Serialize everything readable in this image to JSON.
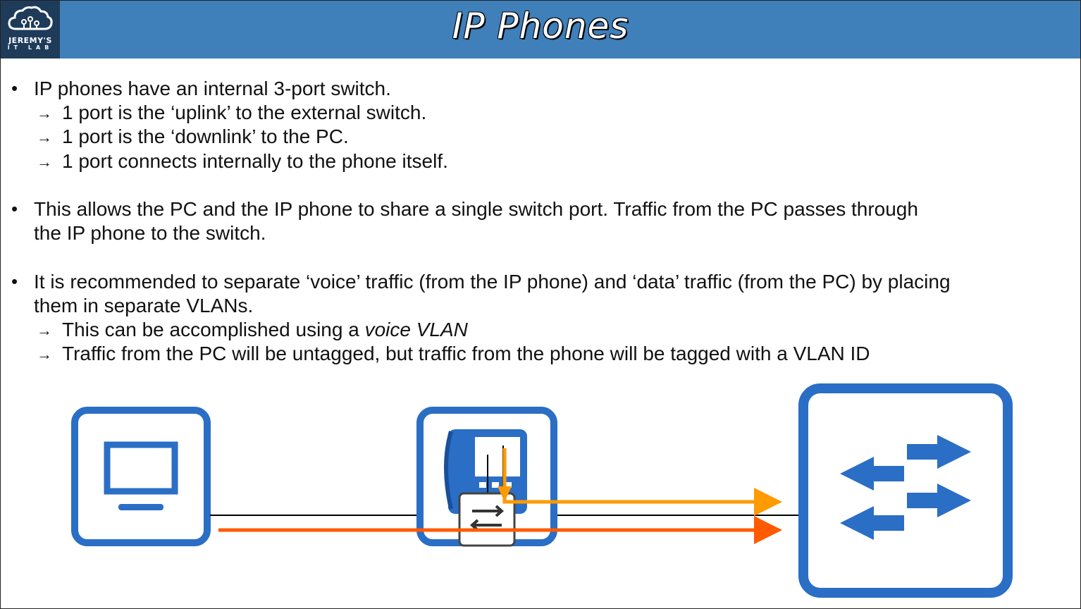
{
  "header": {
    "logo": {
      "line1": "JEREMY'S",
      "line2": "IT LAB",
      "icon": "cloud-network-icon"
    },
    "title": "IP Phones"
  },
  "bullets": [
    {
      "text": "IP phones have an internal 3-port switch.",
      "subs": [
        "1 port is the ‘uplink’ to the external switch.",
        "1 port is the ‘downlink’ to the PC.",
        "1 port connects internally to the phone itself."
      ]
    },
    {
      "lines": [
        "This allows the PC and the IP phone to share a single switch port.  Traffic from the PC passes through",
        "the IP phone to the switch."
      ]
    },
    {
      "lines": [
        "It is recommended to separate ‘voice’ traffic (from the IP phone) and ‘data’ traffic (from the PC) by placing",
        "them in separate VLANs."
      ],
      "subs": [
        {
          "prefix": "This can be accomplished using a ",
          "emph": "voice VLAN"
        },
        {
          "prefix": "Traffic from the PC will be untagged, but traffic from the phone will be tagged with a VLAN ID"
        }
      ]
    }
  ],
  "diagram": {
    "nodes": [
      "pc-icon",
      "ip-phone-icon",
      "switch-icon"
    ],
    "colors": {
      "device_blue": "#2a6ec6",
      "voice_arrow": "#ff9a00",
      "data_arrow": "#ff5a00",
      "link": "#000000"
    }
  }
}
